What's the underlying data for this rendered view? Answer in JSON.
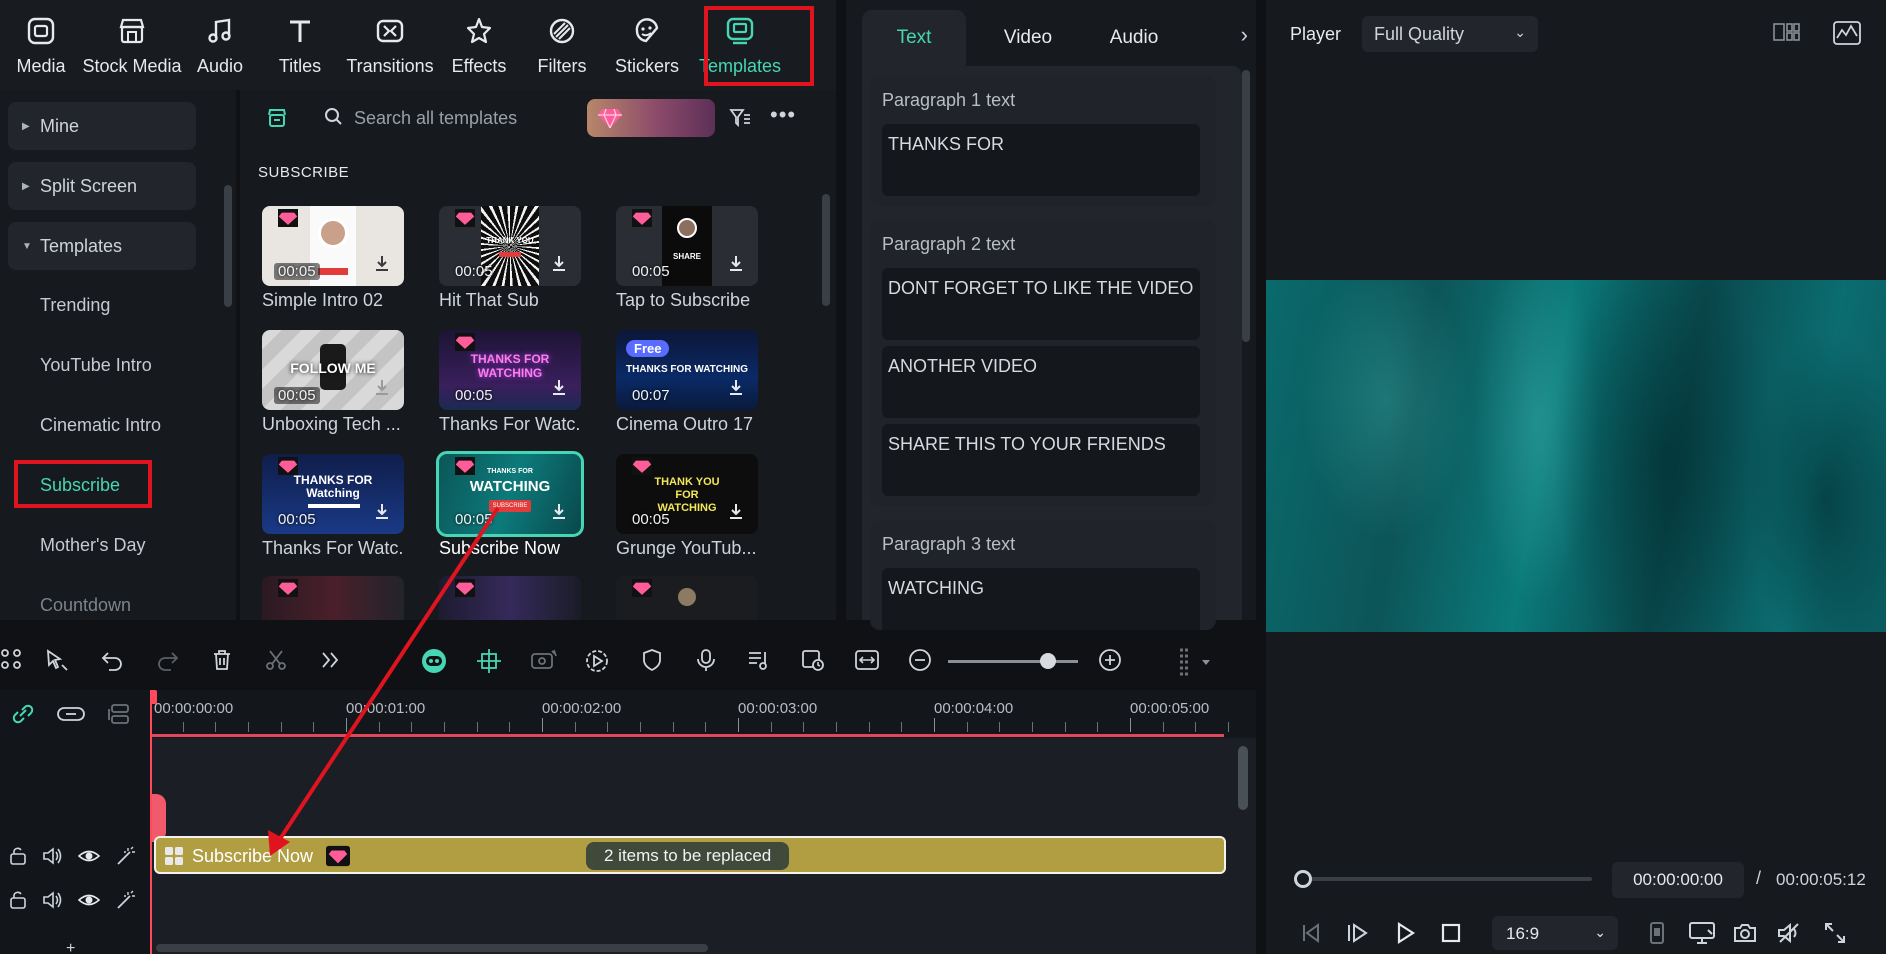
{
  "toolbar": {
    "items": [
      {
        "label": "Media",
        "icon": "media-icon"
      },
      {
        "label": "Stock Media",
        "icon": "stock-media-icon"
      },
      {
        "label": "Audio",
        "icon": "music-note-icon"
      },
      {
        "label": "Titles",
        "icon": "titles-t-icon"
      },
      {
        "label": "Transitions",
        "icon": "transitions-icon"
      },
      {
        "label": "Effects",
        "icon": "effects-star-icon"
      },
      {
        "label": "Filters",
        "icon": "filters-icon"
      },
      {
        "label": "Stickers",
        "icon": "stickers-icon"
      },
      {
        "label": "Templates",
        "icon": "templates-icon"
      }
    ],
    "active": "Templates"
  },
  "leftnav": {
    "groups": [
      {
        "label": "Mine"
      },
      {
        "label": "Split Screen"
      },
      {
        "label": "Templates"
      }
    ],
    "subitems": [
      "Trending",
      "YouTube Intro",
      "Cinematic Intro",
      "Subscribe",
      "Mother's Day",
      "Countdown"
    ],
    "active": "Subscribe"
  },
  "search": {
    "placeholder": "Search all templates"
  },
  "grid": {
    "section": "SUBSCRIBE",
    "cards": [
      {
        "label": "Simple Intro 02",
        "duration": "00:05",
        "premium": true
      },
      {
        "label": "Hit That Sub",
        "duration": "00:05",
        "premium": true,
        "thumb_text": "THANK YOU"
      },
      {
        "label": "Tap to Subscribe",
        "duration": "00:05",
        "premium": true,
        "thumb_text": "SHARE"
      },
      {
        "label": "Unboxing Tech ...",
        "duration": "00:05",
        "premium": false,
        "thumb_text": "FOLLOW ME"
      },
      {
        "label": "Thanks For Watc...",
        "duration": "00:05",
        "premium": true,
        "thumb_text": "THANKS FOR WATCHING"
      },
      {
        "label": "Cinema Outro 17",
        "duration": "00:07",
        "premium": false,
        "free": "Free",
        "thumb_text": "THANKS FOR WATCHING"
      },
      {
        "label": "Thanks For Watc...",
        "duration": "00:05",
        "premium": true,
        "thumb_text": "THANKS FOR Watching"
      },
      {
        "label": "Subscribe Now",
        "duration": "00:05",
        "premium": true,
        "thumb_text": "WATCHING",
        "thumb_small": "THANKS FOR",
        "thumb_btn": "SUBSCRIBE"
      },
      {
        "label": "Grunge YouTub...",
        "duration": "00:05",
        "premium": true,
        "thumb_text": "THANK YOU FOR WATCHING"
      }
    ]
  },
  "props": {
    "tabs": [
      "Text",
      "Video",
      "Audio"
    ],
    "active_tab": "Text",
    "paragraphs": [
      {
        "title": "Paragraph 1 text",
        "fields": [
          "THANKS FOR"
        ]
      },
      {
        "title": "Paragraph 2 text",
        "fields": [
          "DONT FORGET TO LIKE THE VIDEO",
          "ANOTHER VIDEO",
          "SHARE THIS TO YOUR FRIENDS"
        ]
      },
      {
        "title": "Paragraph 3 text",
        "fields": [
          "WATCHING"
        ]
      }
    ]
  },
  "player": {
    "label": "Player",
    "quality": "Full Quality",
    "current_time": "00:00:00:00",
    "separator": "/",
    "total_time": "00:00:05:12",
    "ratio": "16:9",
    "progress": 0
  },
  "timeline": {
    "ruler": [
      "00:00:00:00",
      "00:00:01:00",
      "00:00:02:00",
      "00:00:03:00",
      "00:00:04:00",
      "00:00:05:00"
    ],
    "clip": {
      "name": "Subscribe Now",
      "badge": "2 items to be replaced"
    }
  },
  "colors": {
    "accent": "#46d6b3",
    "highlight": "#e0141e",
    "clip": "#b19e43",
    "playhead": "#ff4a5d"
  }
}
